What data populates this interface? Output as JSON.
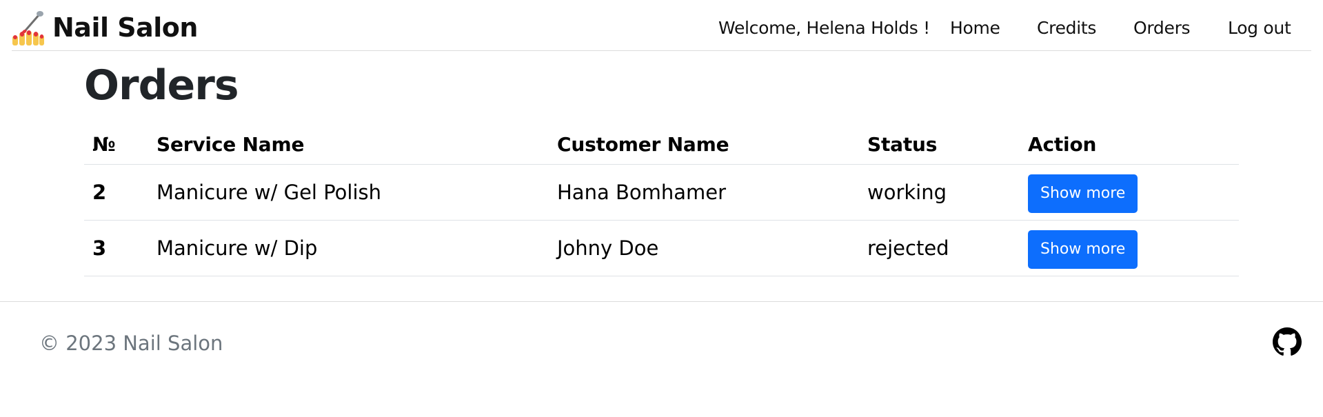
{
  "header": {
    "brand_name": "Nail Salon",
    "brand_logo_icon": "nail-polish-icon",
    "welcome_text": "Welcome, Helena Holds !",
    "nav": {
      "home": "Home",
      "credits": "Credits",
      "orders": "Orders",
      "logout": "Log out"
    }
  },
  "main": {
    "title": "Orders",
    "table": {
      "columns": [
        "№",
        "Service Name",
        "Customer Name",
        "Status",
        "Action"
      ],
      "rows": [
        {
          "number": "2",
          "service": "Manicure w/ Gel Polish",
          "customer": "Hana Bomhamer",
          "status": "working",
          "action": "Show more"
        },
        {
          "number": "3",
          "service": "Manicure w/ Dip",
          "customer": "Johny Doe",
          "status": "rejected",
          "action": "Show more"
        }
      ]
    }
  },
  "footer": {
    "copyright": "© 2023 Nail Salon",
    "github_icon": "github-icon"
  },
  "colors": {
    "primary_button": "#0d6efd",
    "footer_text": "#6c757d",
    "text": "#212529"
  }
}
